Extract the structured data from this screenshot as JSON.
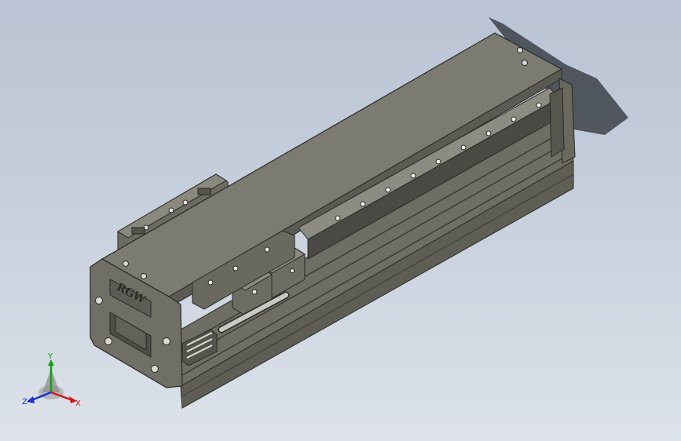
{
  "viewport": {
    "background_top": "#b9c3d3",
    "background_bottom": "#dde2ea"
  },
  "model": {
    "engraved_label": "RGW",
    "body_color": "#707065",
    "top_color": "#7c7b71",
    "edge_color": "#2a2a26",
    "rod_color": "#c9c9c4"
  },
  "triad": {
    "x_label": "X",
    "y_label": "Y",
    "z_label": "Z",
    "x_color": "#d01818",
    "y_color": "#10a010",
    "z_color": "#1830d0"
  }
}
